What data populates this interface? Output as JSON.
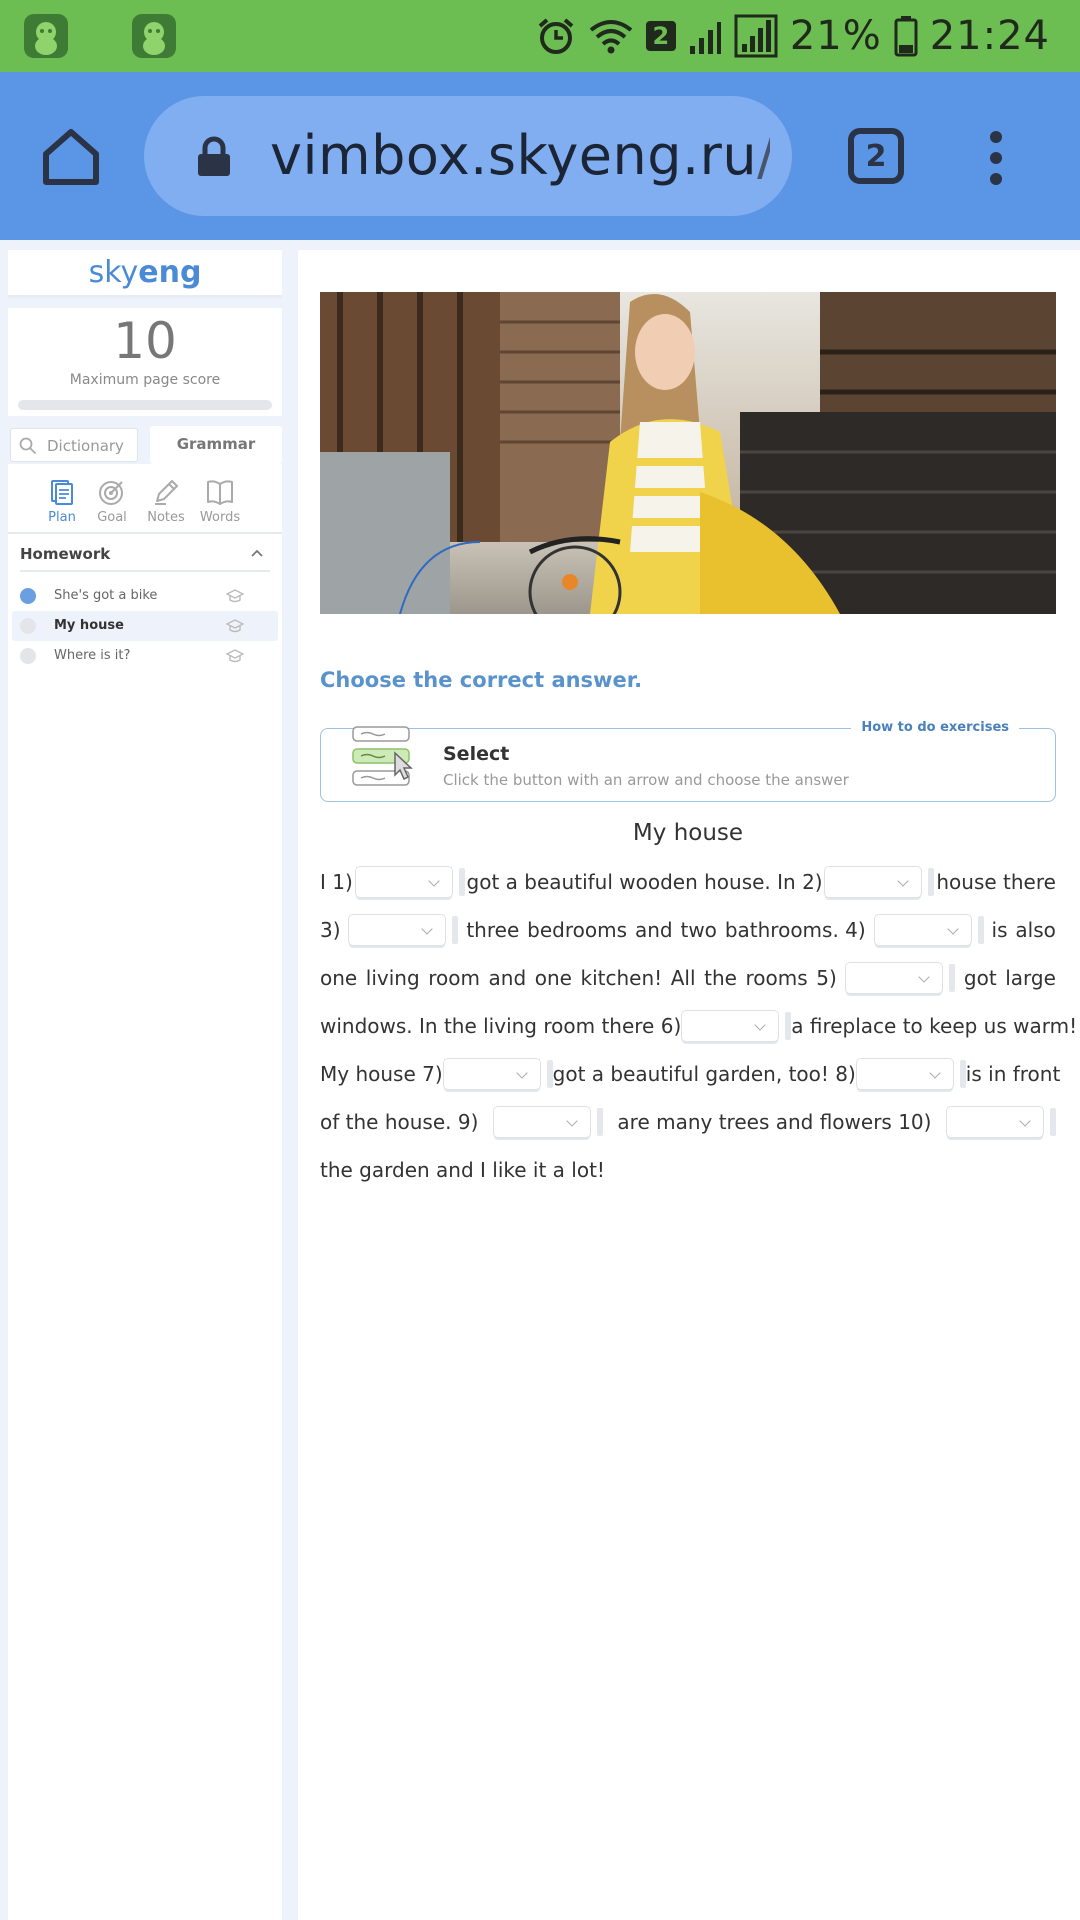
{
  "status_bar": {
    "badge": "2",
    "battery": "21%",
    "time": "21:24"
  },
  "browser": {
    "url_host": "vimbox.skyeng.ru",
    "url_path": "/roo",
    "tab_count": "2"
  },
  "sidebar": {
    "logo_sky": "sky",
    "logo_eng": "eng",
    "score": "10",
    "score_label": "Maximum page score",
    "dictionary_placeholder": "Dictionary",
    "grammar_label": "Grammar",
    "nav": [
      {
        "label": "Plan"
      },
      {
        "label": "Goal"
      },
      {
        "label": "Notes"
      },
      {
        "label": "Words"
      }
    ],
    "homework_title": "Homework",
    "lessons": [
      {
        "label": "She's got a bike"
      },
      {
        "label": "My house"
      },
      {
        "label": "Where is it?"
      }
    ]
  },
  "main": {
    "instruction": "Choose the correct answer.",
    "how_link": "How to do exercises",
    "how_title": "Select",
    "how_desc": "Click the button with an arrow and choose the answer",
    "text_title": "My house",
    "lines": [
      [
        "I 1)",
        "[dd]",
        "got a beautiful wooden house. In 2)",
        "[dd]",
        "house there"
      ],
      [
        "3)",
        "[dd]",
        "three",
        "bedrooms",
        "and",
        "two",
        "bathrooms. 4)",
        "[dd]",
        "is",
        "also"
      ],
      [
        "one",
        "living",
        "room",
        "and",
        "one",
        "kitchen!",
        "All",
        "the",
        "rooms",
        "5)",
        "[dd]",
        "got",
        "large"
      ],
      [
        "windows. In the living room there 6)",
        "[dd]",
        "a fireplace to keep us warm!"
      ],
      [
        "My house 7)",
        "[dd]",
        "got a beautiful garden, too! 8)",
        "[dd]",
        "is in front"
      ],
      [
        "of the house. 9)",
        "[dd]",
        "are many trees and flowers 10)",
        "[dd]"
      ],
      [
        "the garden and I like it a lot!"
      ]
    ]
  },
  "colors": {
    "status_bar": "#6cbd52",
    "browser_bar": "#5b95e6",
    "accent": "#4a8ad7"
  }
}
